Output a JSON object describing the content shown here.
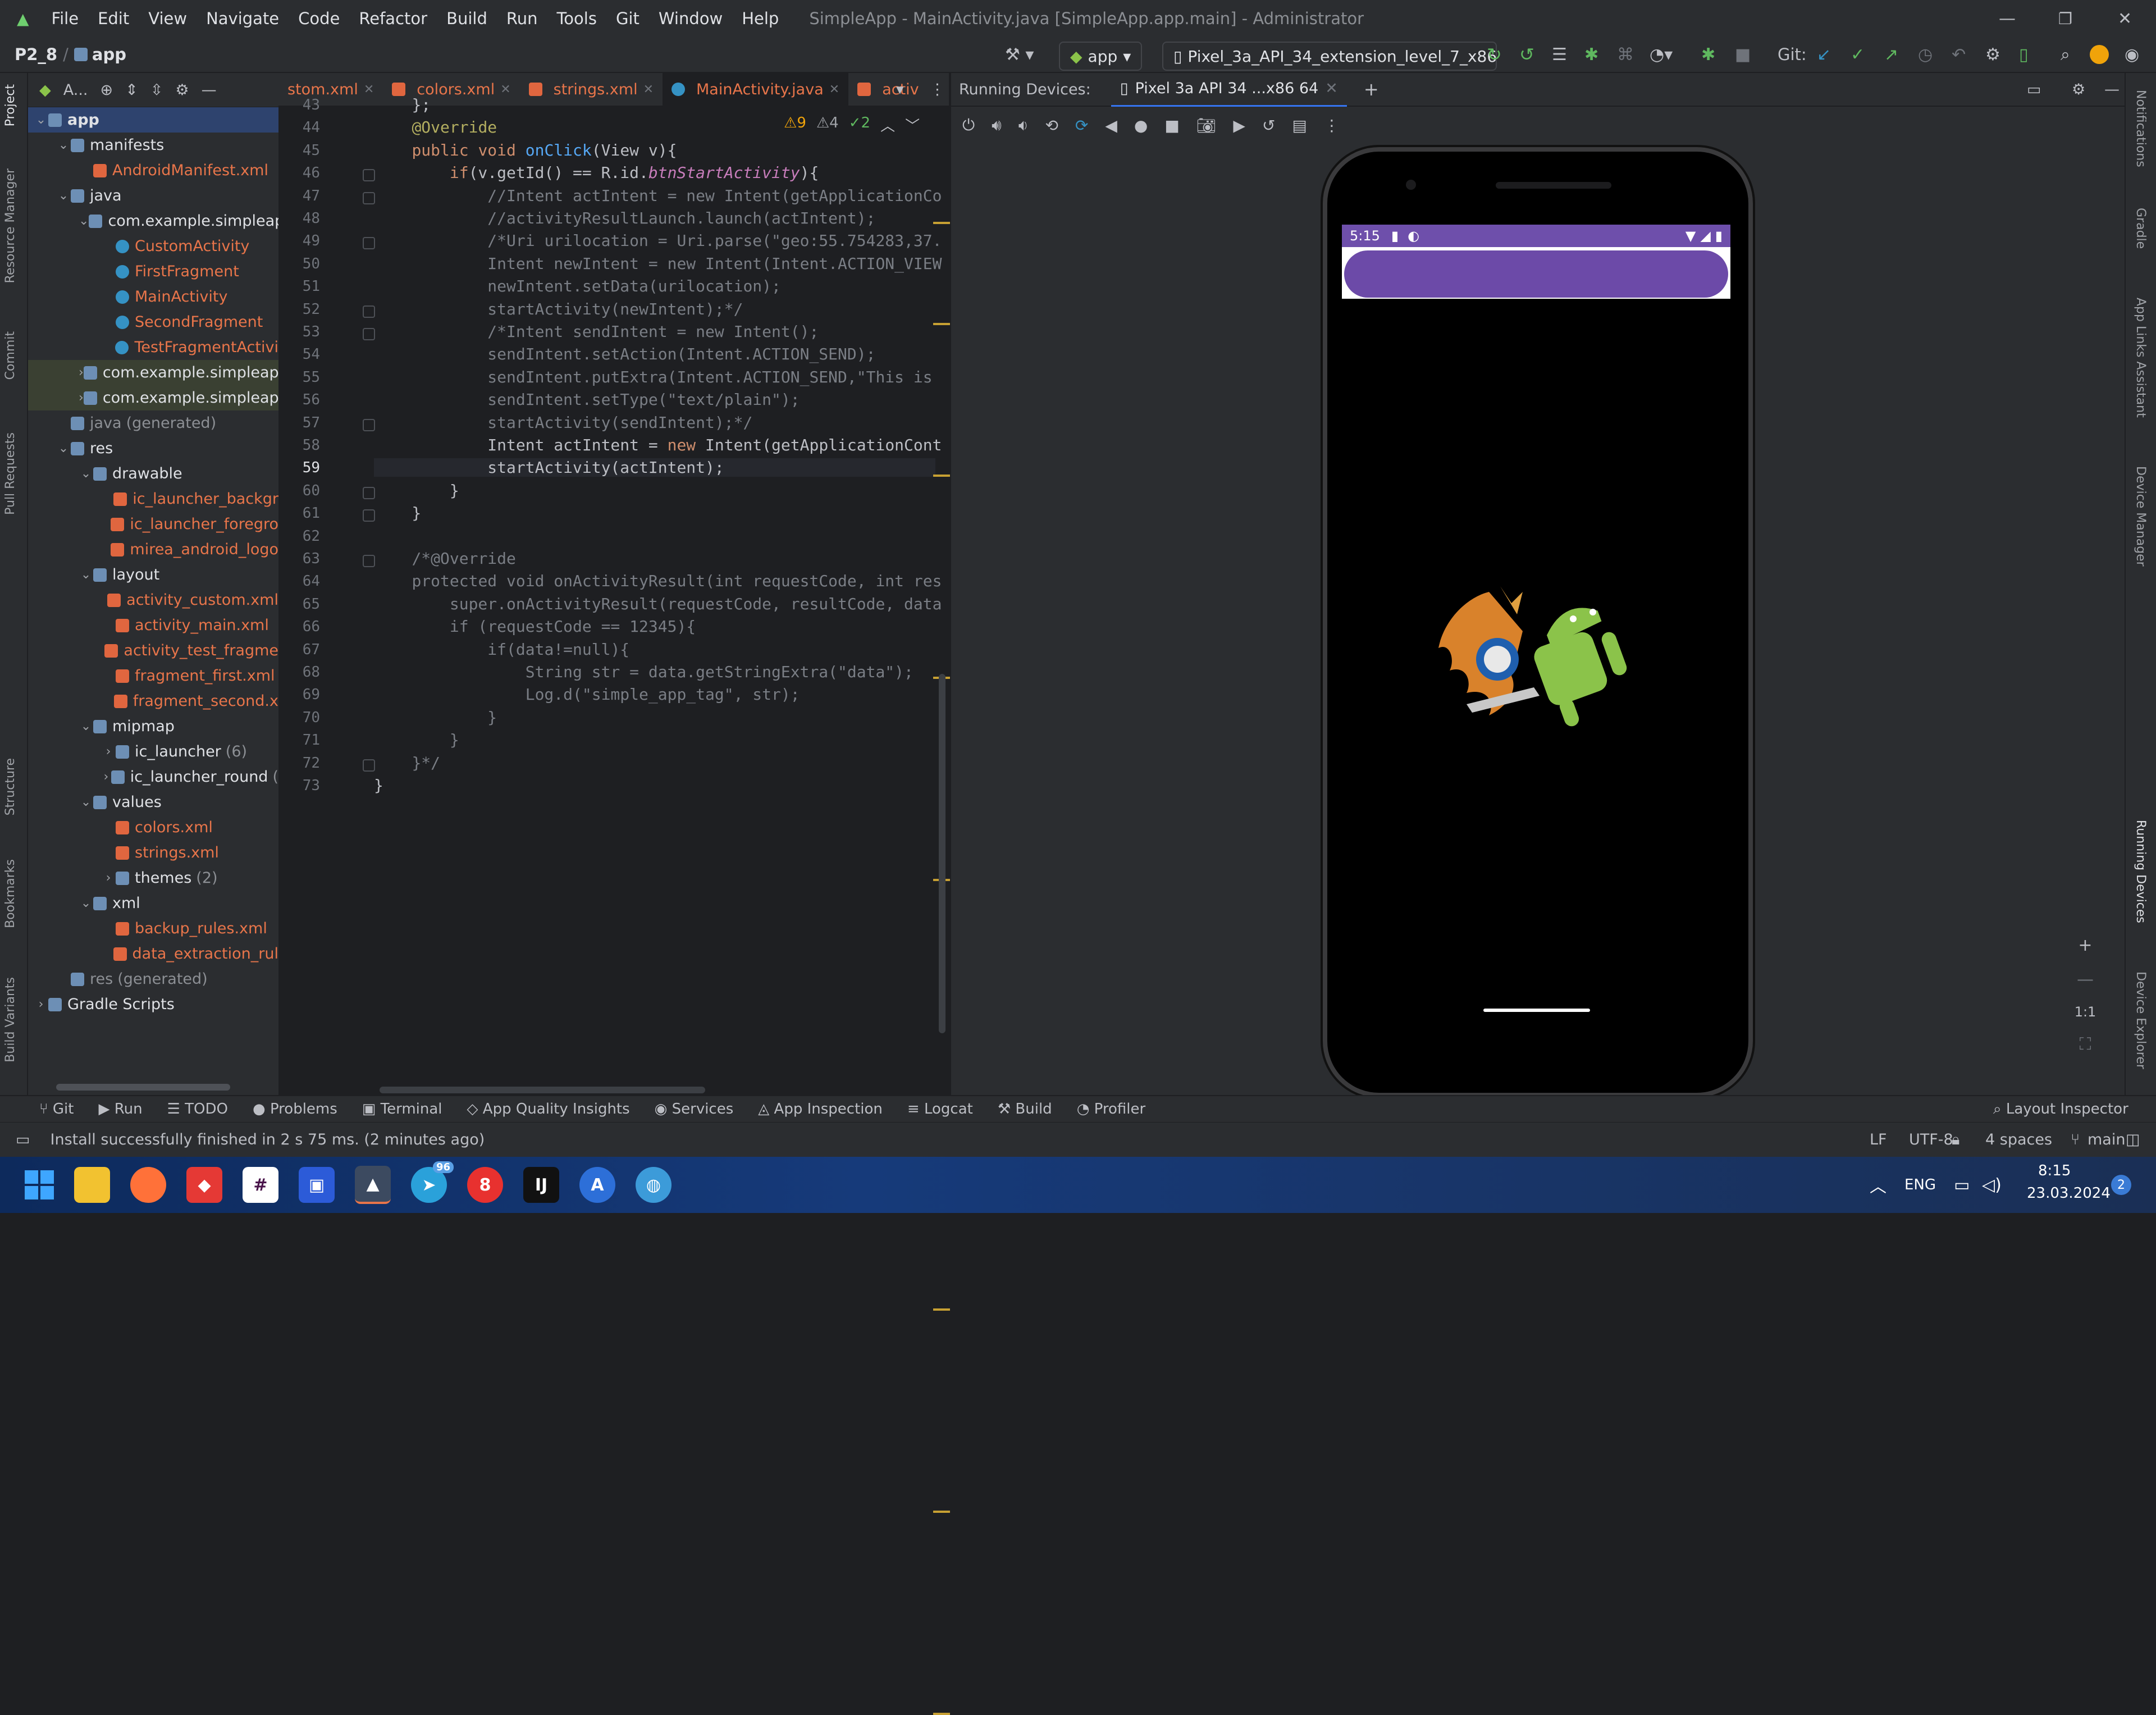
{
  "titlebar": {
    "menus": [
      "File",
      "Edit",
      "View",
      "Navigate",
      "Code",
      "Refactor",
      "Build",
      "Run",
      "Tools",
      "Git",
      "Window",
      "Help"
    ],
    "title": "SimpleApp - MainActivity.java [SimpleApp.app.main] - Administrator"
  },
  "navbar": {
    "project": "P2_8",
    "module": "app",
    "run_config": "app",
    "device": "Pixel_3a_API_34_extension_level_7_x86",
    "git_label": "Git:"
  },
  "left_stripe": [
    "Project",
    "Resource Manager",
    "Commit",
    "Pull Requests",
    "Structure",
    "Bookmarks",
    "Build Variants"
  ],
  "project_panel": {
    "header": "A...",
    "tree": [
      {
        "label": "app",
        "type": "folder",
        "depth": 0,
        "open": true,
        "sel": true
      },
      {
        "label": "manifests",
        "type": "folder",
        "depth": 1,
        "open": true
      },
      {
        "label": "AndroidManifest.xml",
        "type": "xml",
        "depth": 2
      },
      {
        "label": "java",
        "type": "folder",
        "depth": 1,
        "open": true
      },
      {
        "label": "com.example.simpleap",
        "type": "folder",
        "depth": 2,
        "open": true
      },
      {
        "label": "CustomActivity",
        "type": "class",
        "depth": 3
      },
      {
        "label": "FirstFragment",
        "type": "class",
        "depth": 3
      },
      {
        "label": "MainActivity",
        "type": "class",
        "depth": 3
      },
      {
        "label": "SecondFragment",
        "type": "class",
        "depth": 3
      },
      {
        "label": "TestFragmentActivi",
        "type": "class",
        "depth": 3
      },
      {
        "label": "com.example.simpleap",
        "type": "folder",
        "depth": 2,
        "closed": true,
        "hl": true
      },
      {
        "label": "com.example.simpleap",
        "type": "folder",
        "depth": 2,
        "closed": true,
        "hl": true
      },
      {
        "label": "java",
        "extra": "(generated)",
        "type": "folder",
        "depth": 1
      },
      {
        "label": "res",
        "type": "folder",
        "depth": 1,
        "open": true
      },
      {
        "label": "drawable",
        "type": "folder",
        "depth": 2,
        "open": true
      },
      {
        "label": "ic_launcher_backgr",
        "type": "xml",
        "depth": 3
      },
      {
        "label": "ic_launcher_foregro",
        "type": "xml",
        "depth": 3
      },
      {
        "label": "mirea_android_logo",
        "type": "xml",
        "depth": 3
      },
      {
        "label": "layout",
        "type": "folder",
        "depth": 2,
        "open": true
      },
      {
        "label": "activity_custom.xml",
        "type": "xml",
        "depth": 3
      },
      {
        "label": "activity_main.xml",
        "type": "xml",
        "depth": 3
      },
      {
        "label": "activity_test_fragme",
        "type": "xml",
        "depth": 3
      },
      {
        "label": "fragment_first.xml",
        "type": "xml",
        "depth": 3
      },
      {
        "label": "fragment_second.x",
        "type": "xml",
        "depth": 3
      },
      {
        "label": "mipmap",
        "type": "folder",
        "depth": 2,
        "open": true
      },
      {
        "label": "ic_launcher",
        "extra": "(6)",
        "type": "folder",
        "depth": 3,
        "closed": true,
        "plain": true
      },
      {
        "label": "ic_launcher_round",
        "extra": "(",
        "type": "folder",
        "depth": 3,
        "closed": true,
        "plain": true
      },
      {
        "label": "values",
        "type": "folder",
        "depth": 2,
        "open": true
      },
      {
        "label": "colors.xml",
        "type": "xml",
        "depth": 3
      },
      {
        "label": "strings.xml",
        "type": "xml",
        "depth": 3
      },
      {
        "label": "themes",
        "extra": "(2)",
        "type": "folder",
        "depth": 3,
        "closed": true,
        "plain": true
      },
      {
        "label": "xml",
        "type": "folder",
        "depth": 2,
        "open": true
      },
      {
        "label": "backup_rules.xml",
        "type": "xml",
        "depth": 3
      },
      {
        "label": "data_extraction_rul",
        "type": "xml",
        "depth": 3
      },
      {
        "label": "res",
        "extra": "(generated)",
        "type": "folder",
        "depth": 1
      },
      {
        "label": "Gradle Scripts",
        "type": "folder",
        "depth": 0,
        "closed": true,
        "plain": true
      }
    ]
  },
  "editor": {
    "tabs": [
      {
        "label": "stom.xml",
        "active": false
      },
      {
        "label": "colors.xml",
        "active": false
      },
      {
        "label": "strings.xml",
        "active": false
      },
      {
        "label": "MainActivity.java",
        "active": true
      },
      {
        "label": "activ",
        "active": false
      }
    ],
    "inspections": {
      "warnings": "9",
      "weak": "4",
      "ok": "2"
    },
    "lines": [
      {
        "n": "43",
        "html": "    <span>};</span>"
      },
      {
        "n": "44",
        "html": "    <span class='ann'>@Override</span>"
      },
      {
        "n": "45",
        "html": "    <span class='kw'>public void</span> <span class='fn'>onClick</span>(View v){"
      },
      {
        "n": "46",
        "html": "        <span class='kw'>if</span>(v.getId() == R.id.<span class='fld'>btnStartActivity</span>){"
      },
      {
        "n": "47",
        "html": "            <span class='cm'>//Intent actIntent = new Intent(getApplicationCo</span>"
      },
      {
        "n": "48",
        "html": "            <span class='cm'>//activityResultLaunch.launch(actIntent);</span>"
      },
      {
        "n": "49",
        "html": "            <span class='cm'>/*Uri urilocation = Uri.parse(\"geo:55.754283,37.</span>"
      },
      {
        "n": "50",
        "html": "            <span class='cm'>Intent newIntent = new Intent(Intent.ACTION_VIEW</span>"
      },
      {
        "n": "51",
        "html": "            <span class='cm'>newIntent.setData(urilocation);</span>"
      },
      {
        "n": "52",
        "html": "            <span class='cm'>startActivity(newIntent);*/</span>"
      },
      {
        "n": "53",
        "html": "            <span class='cm'>/*Intent sendIntent = new Intent();</span>"
      },
      {
        "n": "54",
        "html": "            <span class='cm'>sendIntent.setAction(Intent.ACTION_SEND);</span>"
      },
      {
        "n": "55",
        "html": "            <span class='cm'>sendIntent.putExtra(Intent.ACTION_SEND,\"This is</span>"
      },
      {
        "n": "56",
        "html": "            <span class='cm'>sendIntent.setType(\"text/plain\");</span>"
      },
      {
        "n": "57",
        "html": "            <span class='cm'>startActivity(sendIntent);*/</span>"
      },
      {
        "n": "58",
        "html": "            Intent actIntent = <span class='kw'>new</span> Intent(getApplicationCont"
      },
      {
        "n": "59",
        "html": "            startActivity(actIntent);"
      },
      {
        "n": "60",
        "html": "        }"
      },
      {
        "n": "61",
        "html": "    }"
      },
      {
        "n": "62",
        "html": ""
      },
      {
        "n": "63",
        "html": "    <span class='cm'>/*@Override</span>"
      },
      {
        "n": "64",
        "html": "    <span class='cm'>protected void onActivityResult(int requestCode, int res</span>"
      },
      {
        "n": "65",
        "html": "        <span class='cm'>super.onActivityResult(requestCode, resultCode, data</span>"
      },
      {
        "n": "66",
        "html": "        <span class='cm'>if (requestCode == 12345){</span>"
      },
      {
        "n": "67",
        "html": "            <span class='cm'>if(data!=null){</span>"
      },
      {
        "n": "68",
        "html": "                <span class='cm'>String str = data.getStringExtra(\"data\");</span>"
      },
      {
        "n": "69",
        "html": "                <span class='cm'>Log.d(\"simple_app_tag\", str);</span>"
      },
      {
        "n": "70",
        "html": "            <span class='cm'>}</span>"
      },
      {
        "n": "71",
        "html": "        <span class='cm'>}</span>"
      },
      {
        "n": "72",
        "html": "    <span class='cm'>}*/</span>"
      },
      {
        "n": "73",
        "html": "}"
      }
    ]
  },
  "running_devices": {
    "label": "Running Devices:",
    "device_tab": "Pixel 3a API 34 ...x86 64",
    "zoom_label": "1:1",
    "phone": {
      "time": "5:15"
    }
  },
  "right_stripe": [
    "Notifications",
    "Gradle",
    "App Links Assistant",
    "Device Manager",
    "Running Devices",
    "Device Explorer"
  ],
  "bottom_tools": [
    "Git",
    "Run",
    "TODO",
    "Problems",
    "Terminal",
    "App Quality Insights",
    "Services",
    "App Inspection",
    "Logcat",
    "Build",
    "Profiler"
  ],
  "layout_inspector": "Layout Inspector",
  "status": {
    "message": "Install successfully finished in 2 s 75 ms. (2 minutes ago)",
    "line_sep": "LF",
    "encoding": "UTF-8",
    "indent": "4 spaces",
    "branch": "main"
  },
  "taskbar": {
    "lang": "ENG",
    "time": "8:15",
    "date": "23.03.2024",
    "notif_count": "2",
    "telegram_badge": "96"
  },
  "colors": {
    "accent": "#3574f0",
    "purple": "#6c4aa8",
    "android": "#8bc34a"
  }
}
